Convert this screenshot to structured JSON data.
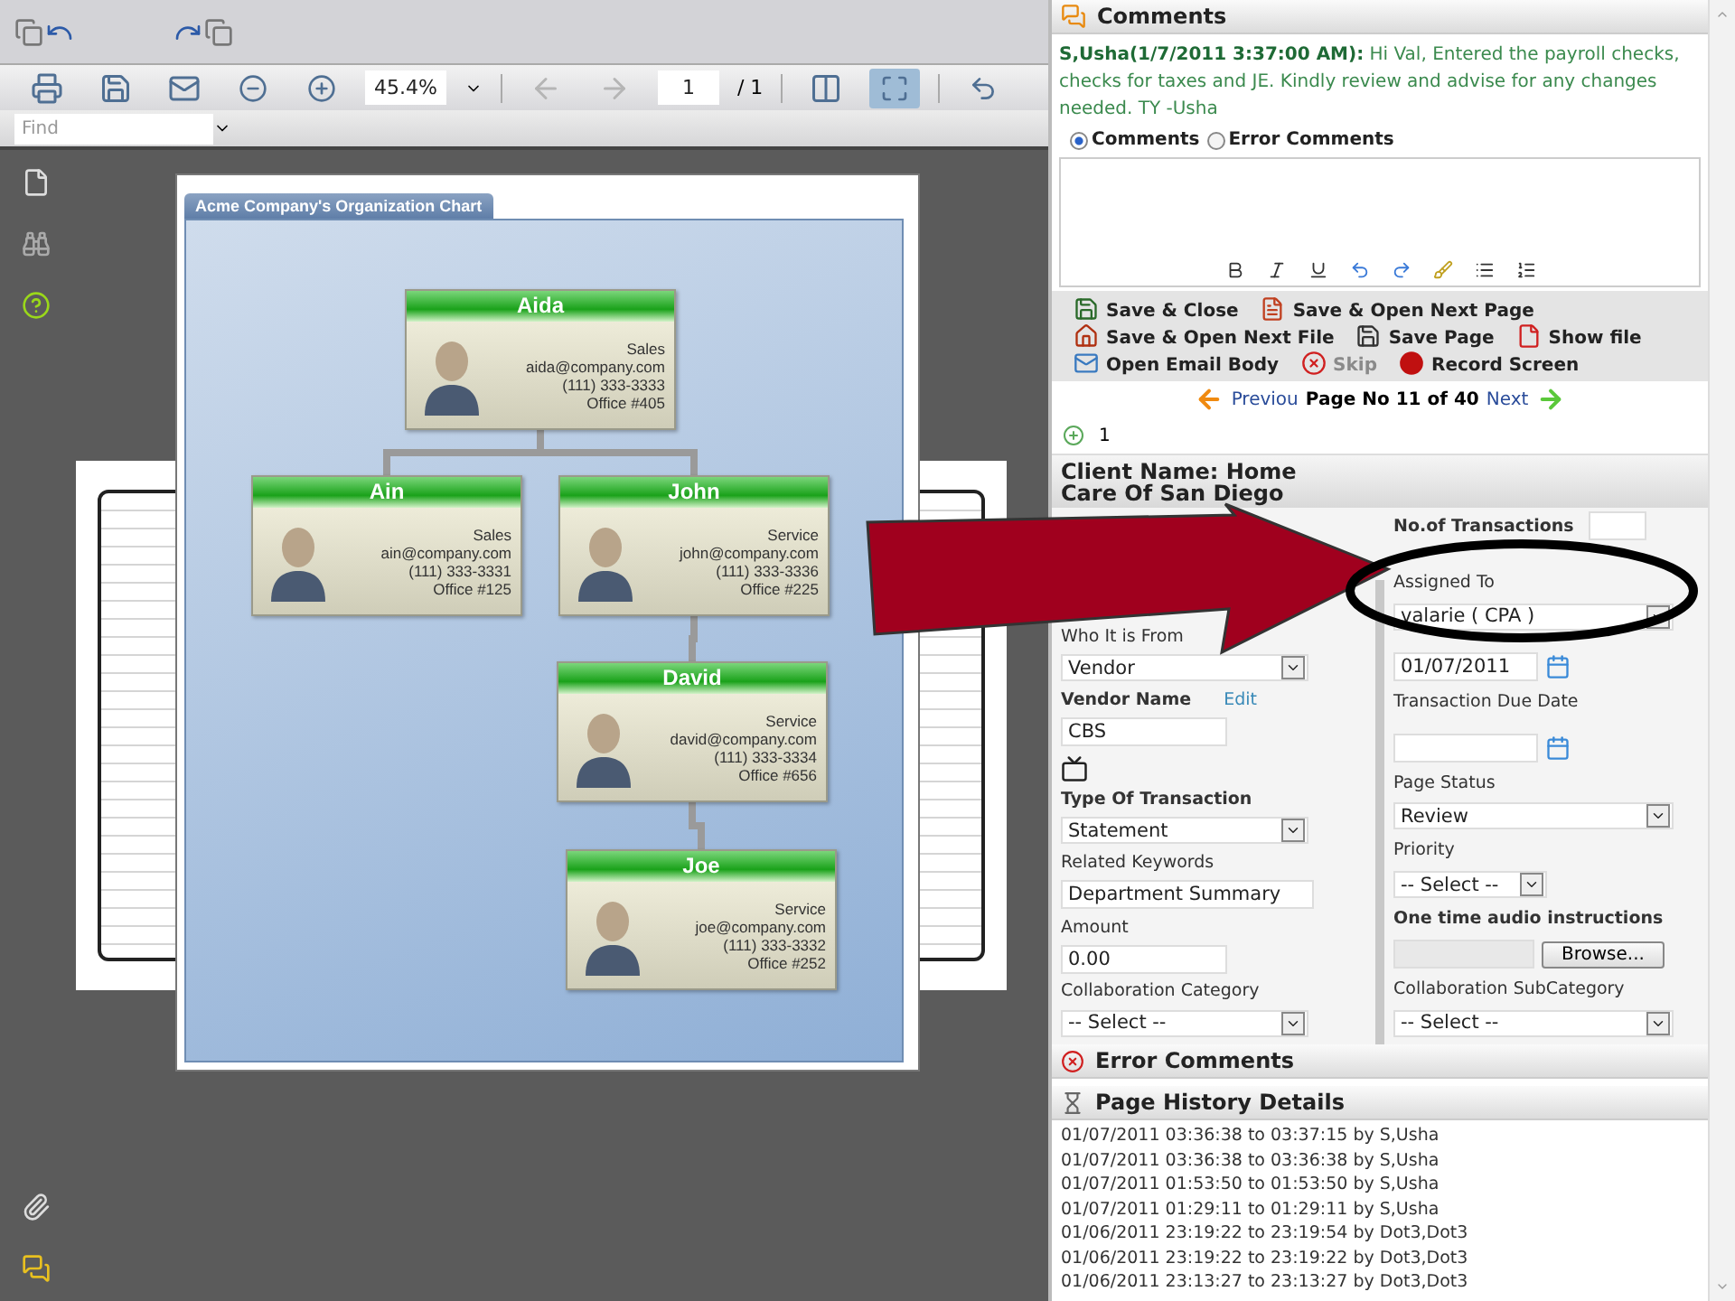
{
  "viewer": {
    "tools": [
      {
        "kind": "print"
      },
      {
        "kind": "save"
      },
      {
        "kind": "email"
      },
      {
        "kind": "zoom-out"
      },
      {
        "kind": "zoom-in"
      }
    ],
    "zoom": "45.4%",
    "nav": [
      {
        "kind": "prev",
        "disabled": true
      },
      {
        "kind": "next",
        "disabled": true
      }
    ],
    "page": "1",
    "page_total": "/ 1",
    "views": [
      {
        "kind": "fit-width",
        "selected": false
      },
      {
        "kind": "fit-page",
        "selected": true
      }
    ],
    "find": {
      "placeholder": "Find"
    }
  },
  "org_chart": {
    "title": "Acme Company's Organization Chart",
    "root": {
      "name": "Aida",
      "dept": "Sales",
      "email": "aida@company.com",
      "phone": "(111) 333-3333",
      "office": "Office #405",
      "children": [
        {
          "name": "Ain",
          "dept": "Sales",
          "email": "ain@company.com",
          "phone": "(111) 333-3331",
          "office": "Office #125"
        },
        {
          "name": "John",
          "dept": "Service",
          "email": "john@company.com",
          "phone": "(111) 333-3336",
          "office": "Office #225",
          "children": [
            {
              "name": "David",
              "dept": "Service",
              "email": "david@company.com",
              "phone": "(111) 333-3334",
              "office": "Office #656",
              "children": [
                {
                  "name": "Joe",
                  "dept": "Service",
                  "email": "joe@company.com",
                  "phone": "(111) 333-3332",
                  "office": "Office #252"
                }
              ]
            }
          ]
        }
      ]
    }
  },
  "comments": {
    "title": "Comments",
    "author": "S,Usha(1/7/2011 3:37:00 AM):",
    "text": "Hi Val, Entered the payroll checks, checks for taxes and JE. Kindly review and advise for any changes needed. TY -Usha",
    "radios": [
      {
        "label": "Comments",
        "selected": true
      },
      {
        "label": "Error Comments",
        "selected": false
      }
    ]
  },
  "actions": [
    {
      "kind": "save-close",
      "label": "Save & Close",
      "disabled": false
    },
    {
      "kind": "save-next-page",
      "label": "Save & Open Next Page",
      "disabled": false
    },
    {
      "kind": "save-next-file",
      "label": "Save & Open Next File",
      "disabled": false
    },
    {
      "kind": "save-page",
      "label": "Save Page",
      "disabled": false
    },
    {
      "kind": "show-file",
      "label": "Show file",
      "disabled": false
    },
    {
      "kind": "email",
      "label": "Open Email Body",
      "disabled": false
    },
    {
      "kind": "skip",
      "label": "Skip",
      "disabled": true
    },
    {
      "kind": "record",
      "label": "Record Screen",
      "disabled": false
    }
  ],
  "pager": {
    "prev": "Previou",
    "page": "Page No 11 of 40",
    "next": "Next"
  },
  "count": "1",
  "client": "Client Name: Home Care Of San Diego",
  "form": {
    "left": [
      {
        "kind": "label",
        "text": "Who It is From"
      },
      {
        "kind": "select",
        "value": "Vendor"
      },
      {
        "kind": "label",
        "text": "Vendor Name",
        "bold": true,
        "link": "Edit"
      },
      {
        "kind": "input",
        "value": "CBS"
      },
      {
        "kind": "icon"
      },
      {
        "kind": "label",
        "text": "Type Of Transaction",
        "bold": true
      },
      {
        "kind": "select",
        "value": "Statement"
      },
      {
        "kind": "label",
        "text": "Related Keywords"
      },
      {
        "kind": "input",
        "value": "Department Summary"
      },
      {
        "kind": "label",
        "text": "Amount"
      },
      {
        "kind": "input",
        "value": "0.00"
      },
      {
        "kind": "label",
        "text": "Collaboration Category"
      },
      {
        "kind": "select",
        "value": "-- Select --"
      }
    ],
    "right": [
      {
        "kind": "count",
        "text": "No.of Transactions",
        "bold": true
      },
      {
        "kind": "label",
        "text": "Assigned To"
      },
      {
        "kind": "select",
        "value": "valarie ( CPA )"
      },
      {
        "kind": "date",
        "value": "01/07/2011"
      },
      {
        "kind": "label",
        "text": "Transaction Due Date"
      },
      {
        "kind": "date"
      },
      {
        "kind": "label",
        "text": "Page Status"
      },
      {
        "kind": "select",
        "value": "Review"
      },
      {
        "kind": "label",
        "text": "Priority"
      },
      {
        "kind": "small-select",
        "value": "-- Select --"
      },
      {
        "kind": "label",
        "text": "One time audio instructions",
        "bold": true
      },
      {
        "kind": "file",
        "button": "Browse..."
      },
      {
        "kind": "label",
        "text": "Collaboration SubCategory"
      },
      {
        "kind": "select",
        "value": "-- Select --"
      }
    ]
  },
  "error_comments": {
    "title": "Error Comments"
  },
  "history": {
    "title": "Page History Details",
    "rows": [
      "01/07/2011 03:36:38 to 03:37:15 by S,Usha",
      "01/07/2011 03:36:38 to 03:36:38 by S,Usha",
      "01/07/2011 01:53:50 to 01:53:50 by S,Usha",
      "01/07/2011 01:29:11 to 01:29:11 by S,Usha",
      "01/06/2011 23:19:22 to 23:19:54 by Dot3,Dot3",
      "01/06/2011 23:19:22 to 23:19:22 by Dot3,Dot3",
      "01/06/2011 23:13:27 to 23:13:27 by Dot3,Dot3"
    ]
  }
}
